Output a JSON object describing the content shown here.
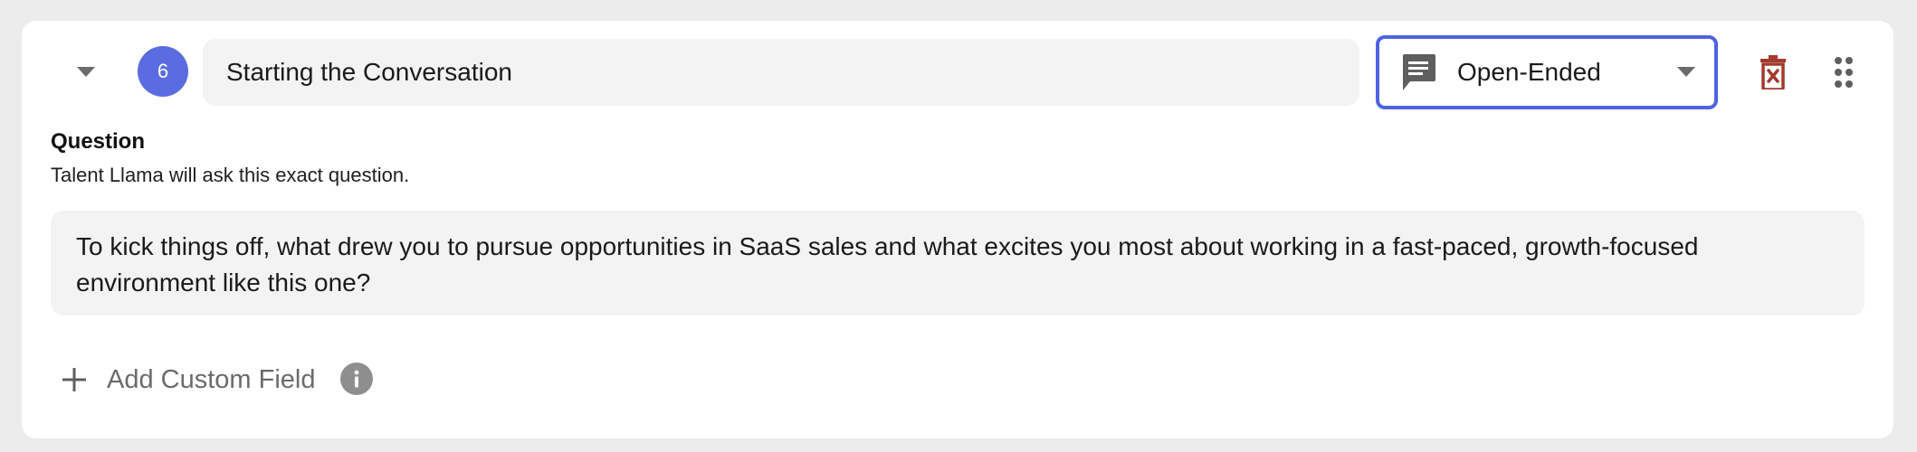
{
  "question_card": {
    "step_number": "6",
    "title": "Starting the Conversation",
    "type_select": {
      "selected": "Open-Ended",
      "icon": "chat-bubble-icon"
    },
    "question": {
      "heading": "Question",
      "helper": "Talent Llama will ask this exact question.",
      "text": "To kick things off, what drew you to pursue opportunities in SaaS sales and what excites you most about working in a fast-paced, growth-focused environment like this one?"
    },
    "add_custom_field_label": "Add Custom Field"
  },
  "colors": {
    "accent": "#4f63e0",
    "badge": "#5b6ce0",
    "delete": "#a33a2e",
    "field_bg": "#f3f3f3"
  }
}
